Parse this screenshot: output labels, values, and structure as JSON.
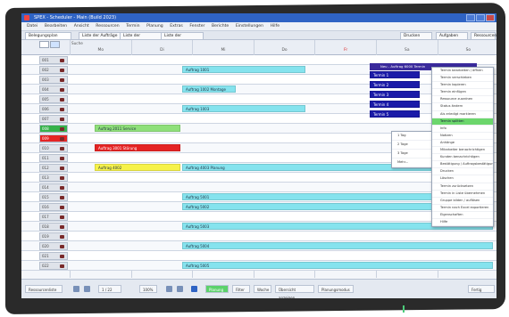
{
  "window": {
    "title": "SPEX - Scheduler - Main (Build 2023)",
    "buttons": [
      "_",
      "□",
      "×"
    ]
  },
  "menu": [
    "Datei",
    "Bearbeiten",
    "Ansicht",
    "Ressourcen",
    "Termin",
    "Planung",
    "Extras",
    "Fenster",
    "Berichte",
    "Einstellungen",
    "Hilfe"
  ],
  "tabs": [
    {
      "label": "Belegungsplan",
      "active": true
    },
    {
      "label": "Liste der Aufträge",
      "active": false
    },
    {
      "label": "Liste der Ressourcen",
      "active": false
    },
    {
      "label": "Liste der Personen",
      "active": false
    }
  ],
  "header": {
    "search_label": "Suche",
    "days": [
      {
        "label": "Mo",
        "weekend": false
      },
      {
        "label": "Di",
        "weekend": false
      },
      {
        "label": "Mi",
        "weekend": false
      },
      {
        "label": "Do",
        "weekend": false
      },
      {
        "label": "Fr",
        "weekend": true
      },
      {
        "label": "Sa",
        "weekend": false
      },
      {
        "label": "So",
        "weekend": false
      }
    ],
    "right_buttons": [
      "Drucken",
      "Aufgaben zeigen",
      "Ressourcenplan"
    ]
  },
  "rows": [
    {
      "label": "001",
      "status": "normal"
    },
    {
      "label": "002",
      "status": "normal"
    },
    {
      "label": "003",
      "status": "normal"
    },
    {
      "label": "004",
      "status": "normal"
    },
    {
      "label": "005",
      "status": "normal"
    },
    {
      "label": "006",
      "status": "normal"
    },
    {
      "label": "007",
      "status": "normal"
    },
    {
      "label": "008",
      "status": "green"
    },
    {
      "label": "009",
      "status": "red"
    },
    {
      "label": "010",
      "status": "normal"
    },
    {
      "label": "011",
      "status": "normal"
    },
    {
      "label": "012",
      "status": "normal"
    },
    {
      "label": "013",
      "status": "normal"
    },
    {
      "label": "014",
      "status": "normal"
    },
    {
      "label": "015",
      "status": "normal"
    },
    {
      "label": "016",
      "status": "normal"
    },
    {
      "label": "017",
      "status": "normal"
    },
    {
      "label": "018",
      "status": "normal"
    },
    {
      "label": "019",
      "status": "normal"
    },
    {
      "label": "020",
      "status": "normal"
    },
    {
      "label": "021",
      "status": "normal"
    },
    {
      "label": "022",
      "status": "normal"
    }
  ],
  "appointments": [
    {
      "row": 1,
      "label": "Auftrag 1001",
      "color": "cyan"
    },
    {
      "row": 3,
      "label": "Auftrag 1002 Montage",
      "color": "cyan"
    },
    {
      "row": 5,
      "label": "Auftrag 1003",
      "color": "cyan"
    },
    {
      "row": 7,
      "label": "Auftrag 2011 Service",
      "color": "green"
    },
    {
      "row": 9,
      "label": "Auftrag 3001 Störung",
      "color": "red"
    },
    {
      "row": 11,
      "label": "Auftrag 4002",
      "color": "yellow"
    },
    {
      "row": 11,
      "label": "Auftrag 4003 Planung",
      "color": "cyan"
    },
    {
      "row": 14,
      "label": "Auftrag 5001",
      "color": "cyan"
    },
    {
      "row": 15,
      "label": "Auftrag 5002",
      "color": "cyan"
    },
    {
      "row": 17,
      "label": "Auftrag 5003",
      "color": "cyan"
    },
    {
      "row": 19,
      "label": "Auftrag 5004",
      "color": "cyan"
    },
    {
      "row": 21,
      "label": "Auftrag 5005",
      "color": "cyan"
    }
  ],
  "selected_block": {
    "title": "Neu - Auftrag 6000 Termin",
    "items": [
      "Termin 1",
      "Termin 2",
      "Termin 3",
      "Termin 4",
      "Termin 5"
    ]
  },
  "context_menu": {
    "items": [
      {
        "label": "Termin bearbeiten / öffnen",
        "highlighted": false
      },
      {
        "label": "Termin verschieben",
        "highlighted": false
      },
      {
        "label": "Termin kopieren",
        "highlighted": false
      },
      {
        "label": "Termin einfügen",
        "highlighted": false
      },
      {
        "label": "Ressource zuordnen",
        "highlighted": false
      },
      {
        "label": "Status ändern",
        "highlighted": false
      },
      {
        "label": "Als erledigt markieren",
        "highlighted": false
      },
      {
        "label": "Termin splitten",
        "highlighted": true
      },
      {
        "label": "Info",
        "highlighted": false
      },
      {
        "label": "Notizen",
        "highlighted": false
      },
      {
        "label": "Anhänge",
        "highlighted": false
      },
      {
        "label": "Mitarbeiter benachrichtigen",
        "highlighted": false
      },
      {
        "label": "Kunden benachrichtigen",
        "highlighted": false
      },
      {
        "label": "Bestätigung / Auftragsbestätigung",
        "highlighted": false
      },
      {
        "label": "Drucken",
        "highlighted": false
      },
      {
        "label": "Löschen",
        "highlighted": false
      },
      {
        "label": "Termin zurücksetzen",
        "highlighted": false
      },
      {
        "label": "Termin in Liste übernehmen",
        "highlighted": false
      },
      {
        "label": "Gruppe bilden / auflösen",
        "highlighted": false
      },
      {
        "label": "Termin nach Excel exportieren",
        "highlighted": false
      },
      {
        "label": "Eigenschaften",
        "highlighted": false
      },
      {
        "label": "Hilfe",
        "highlighted": false
      }
    ]
  },
  "sub_menu": {
    "items": [
      "1 Tag",
      "2 Tage",
      "3 Tage",
      "Mehr..."
    ]
  },
  "status": {
    "left": "Ressourcenliste",
    "page": "1 / 22",
    "zoom": "100%",
    "mode": "Planung",
    "items": [
      "Filter",
      "Woche",
      "Übersicht anzeigen",
      "Planungsmodus",
      "Fertig"
    ]
  }
}
